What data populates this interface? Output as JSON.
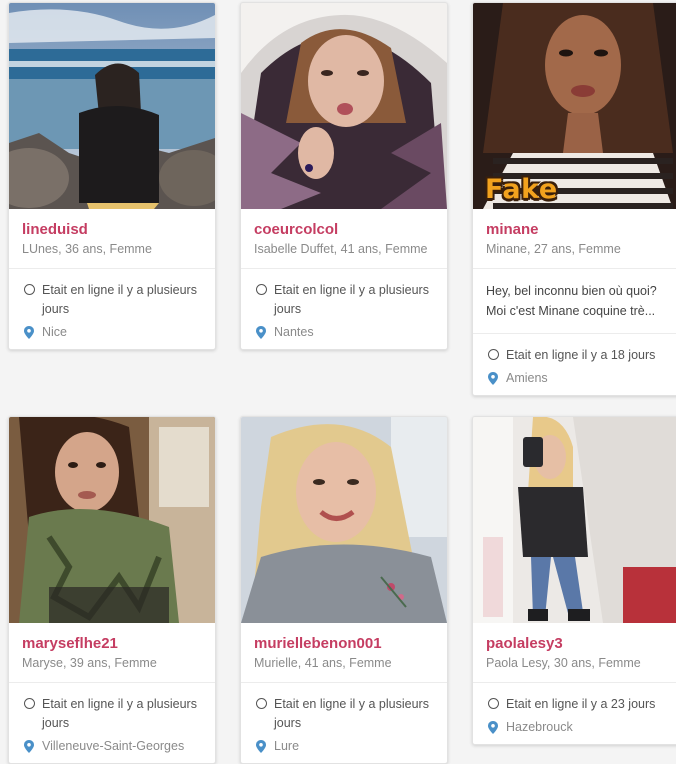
{
  "profiles": [
    {
      "username": "lineduisd",
      "details": "LUnes, 36 ans, Femme",
      "status": "Etait en ligne il y a plusieurs jours",
      "location": "Nice"
    },
    {
      "username": "coeurcolcol",
      "details": "Isabelle Duffet, 41 ans, Femme",
      "status": "Etait en ligne il y a plusieurs jours",
      "location": "Nantes"
    },
    {
      "username": "minane",
      "details": "Minane, 27 ans, Femme",
      "badge": "Fake",
      "message_line1": "Hey, bel inconnu bien où quoi?",
      "message_line2": "Moi c'est Minane coquine trè...",
      "status": "Etait en ligne il y a 18 jours",
      "location": "Amiens"
    },
    {
      "username": "maryseflhe21",
      "details": "Maryse, 39 ans, Femme",
      "status": "Etait en ligne il y a plusieurs jours",
      "location": "Villeneuve-Saint-Georges"
    },
    {
      "username": "muriellebenon001",
      "details": "Murielle, 41 ans, Femme",
      "status": "Etait en ligne il y a plusieurs jours",
      "location": "Lure"
    },
    {
      "username": "paolalesy3",
      "details": "Paola Lesy, 30 ans, Femme",
      "status": "Etait en ligne il y a 23 jours",
      "location": "Hazebrouck"
    }
  ],
  "icons": {
    "status": "status-circle-icon",
    "location": "map-pin-icon"
  },
  "colors": {
    "username": "#c53d62",
    "location_pin": "#4a90c8",
    "background": "#f4f4f4"
  }
}
